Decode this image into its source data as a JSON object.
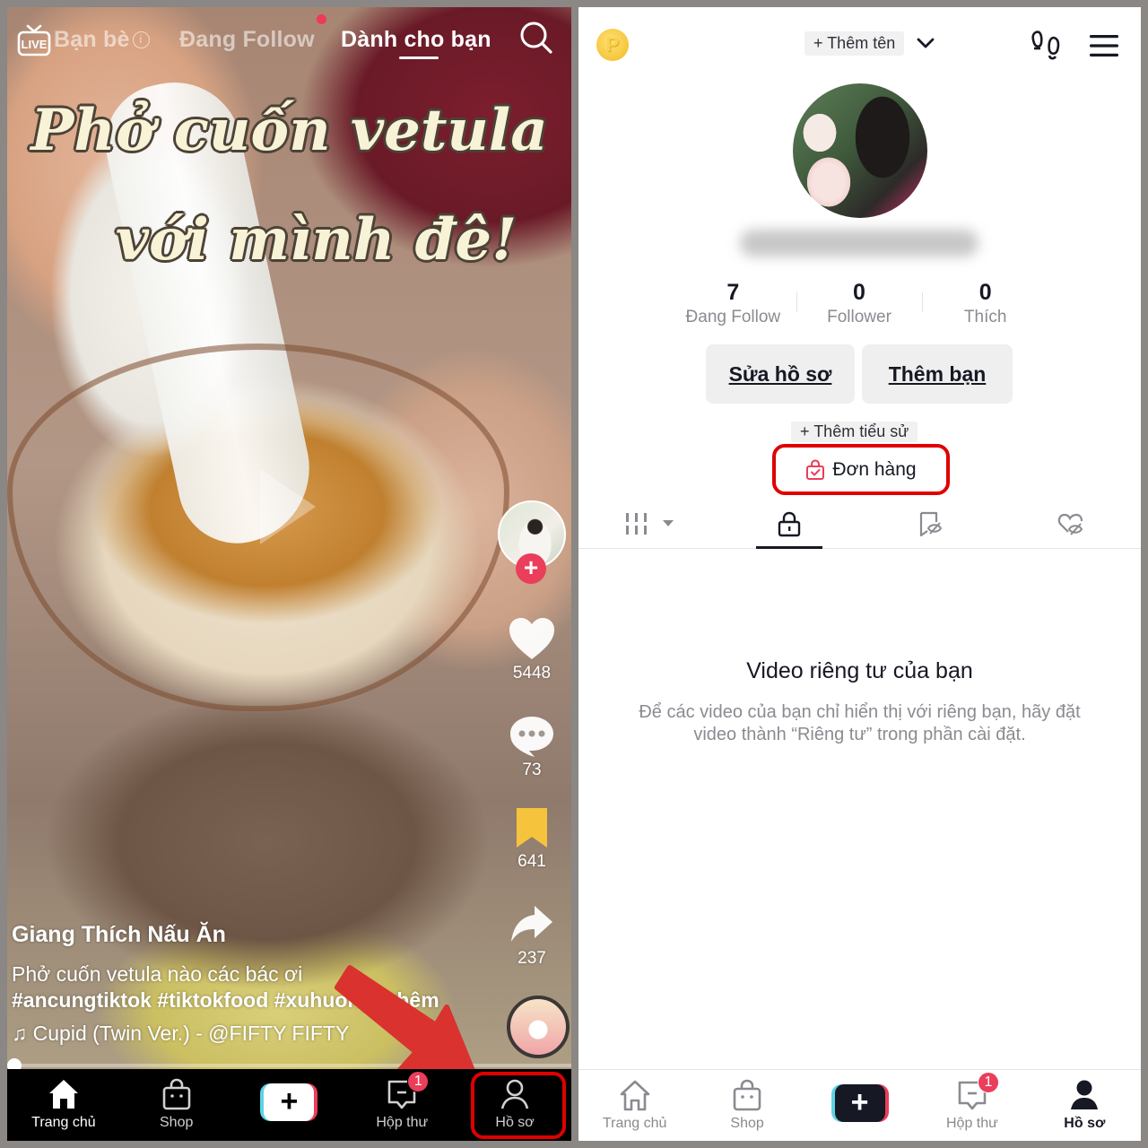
{
  "feed": {
    "top_tabs": [
      {
        "label": "Bạn bè"
      },
      {
        "label": "Đang Follow"
      },
      {
        "label": "Dành cho bạn",
        "active": true
      }
    ],
    "live_label": "LIVE",
    "video_overlay": {
      "line1": "Phở cuốn vetula",
      "line2": "với mình đê!"
    },
    "actions": {
      "likes": "5448",
      "comments": "73",
      "bookmarks": "641",
      "shares": "237"
    },
    "caption": {
      "author": "Giang Thích Nấu Ăn",
      "description": "Phở cuốn vetula nào các bác ơi",
      "hashtags": "#ancungtiktok #tiktokfood #xuhuong #thêm",
      "music_icon": "♫",
      "music": "Cupid (Twin Ver.) - @FIFTY FIFTY"
    },
    "video_progress": 0.0,
    "nav": [
      {
        "label": "Trang chủ",
        "icon": "home-icon",
        "active": true
      },
      {
        "label": "Shop",
        "icon": "shop-bag-icon"
      },
      {
        "label": "",
        "icon": "create-plus-icon"
      },
      {
        "label": "Hộp thư",
        "icon": "inbox-icon",
        "badge": "1"
      },
      {
        "label": "Hồ sơ",
        "icon": "profile-icon",
        "highlighted": true
      }
    ]
  },
  "profile": {
    "add_name_label": "+ Thêm tên",
    "coin_symbol": "P",
    "stats": [
      {
        "value": "7",
        "label": "Đang Follow"
      },
      {
        "value": "0",
        "label": "Follower"
      },
      {
        "value": "0",
        "label": "Thích"
      }
    ],
    "edit_profile_label": "Sửa hồ sơ",
    "add_friends_label": "Thêm bạn",
    "add_bio_label": "+ Thêm tiểu sử",
    "orders_label": "Đơn hàng",
    "content_tabs": [
      "videos-grid",
      "private",
      "favorites-hidden",
      "liked-hidden"
    ],
    "empty_state": {
      "title": "Video riêng tư của bạn",
      "description": "Để các video của bạn chỉ hiển thị với riêng bạn, hãy đặt video thành “Riêng tư” trong phần cài đặt."
    },
    "nav": [
      {
        "label": "Trang chủ",
        "icon": "home-icon"
      },
      {
        "label": "Shop",
        "icon": "shop-bag-icon"
      },
      {
        "label": "",
        "icon": "create-plus-icon"
      },
      {
        "label": "Hộp thư",
        "icon": "inbox-icon",
        "badge": "1"
      },
      {
        "label": "Hồ sơ",
        "icon": "profile-icon",
        "active": true
      }
    ]
  },
  "colors": {
    "accent_red": "#ea3e5a",
    "highlight_red": "#e00000",
    "create_cyan": "#5ed3e6",
    "text_primary": "#161823",
    "text_secondary": "#8a8b91",
    "bookmark_yellow": "#f5c43c"
  }
}
